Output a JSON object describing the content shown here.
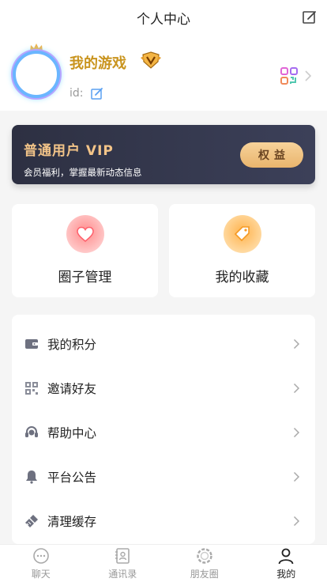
{
  "header": {
    "title": "个人中心",
    "edit_icon": "edit-icon"
  },
  "profile": {
    "nickname": "我的游戏",
    "id_label": "id:",
    "badge_icon": "vip-level-badge-icon",
    "qr_icon": "qr-code-icon"
  },
  "vip_card": {
    "title": "普通用户 VIP",
    "subtitle": "会员福利，掌握最新动态信息",
    "button_label": "权益"
  },
  "tiles": [
    {
      "label": "圈子管理",
      "icon": "heart-icon",
      "color": "#ff6b6b"
    },
    {
      "label": "我的收藏",
      "icon": "tag-icon",
      "color": "#ffa42d"
    }
  ],
  "menu": [
    {
      "label": "我的积分",
      "icon": "wallet-icon"
    },
    {
      "label": "邀请好友",
      "icon": "qr-icon"
    },
    {
      "label": "帮助中心",
      "icon": "headset-icon"
    },
    {
      "label": "平台公告",
      "icon": "bell-icon"
    },
    {
      "label": "清理缓存",
      "icon": "broom-icon"
    }
  ],
  "tabbar": [
    {
      "label": "聊天",
      "icon": "chat-icon",
      "active": false
    },
    {
      "label": "通讯录",
      "icon": "contacts-icon",
      "active": false
    },
    {
      "label": "朋友圈",
      "icon": "moments-icon",
      "active": false
    },
    {
      "label": "我的",
      "icon": "user-icon",
      "active": true
    }
  ],
  "colors": {
    "accent_gold": "#c9941e",
    "vip_card_bg": "#2d3042",
    "vip_text": "#f3c488"
  }
}
